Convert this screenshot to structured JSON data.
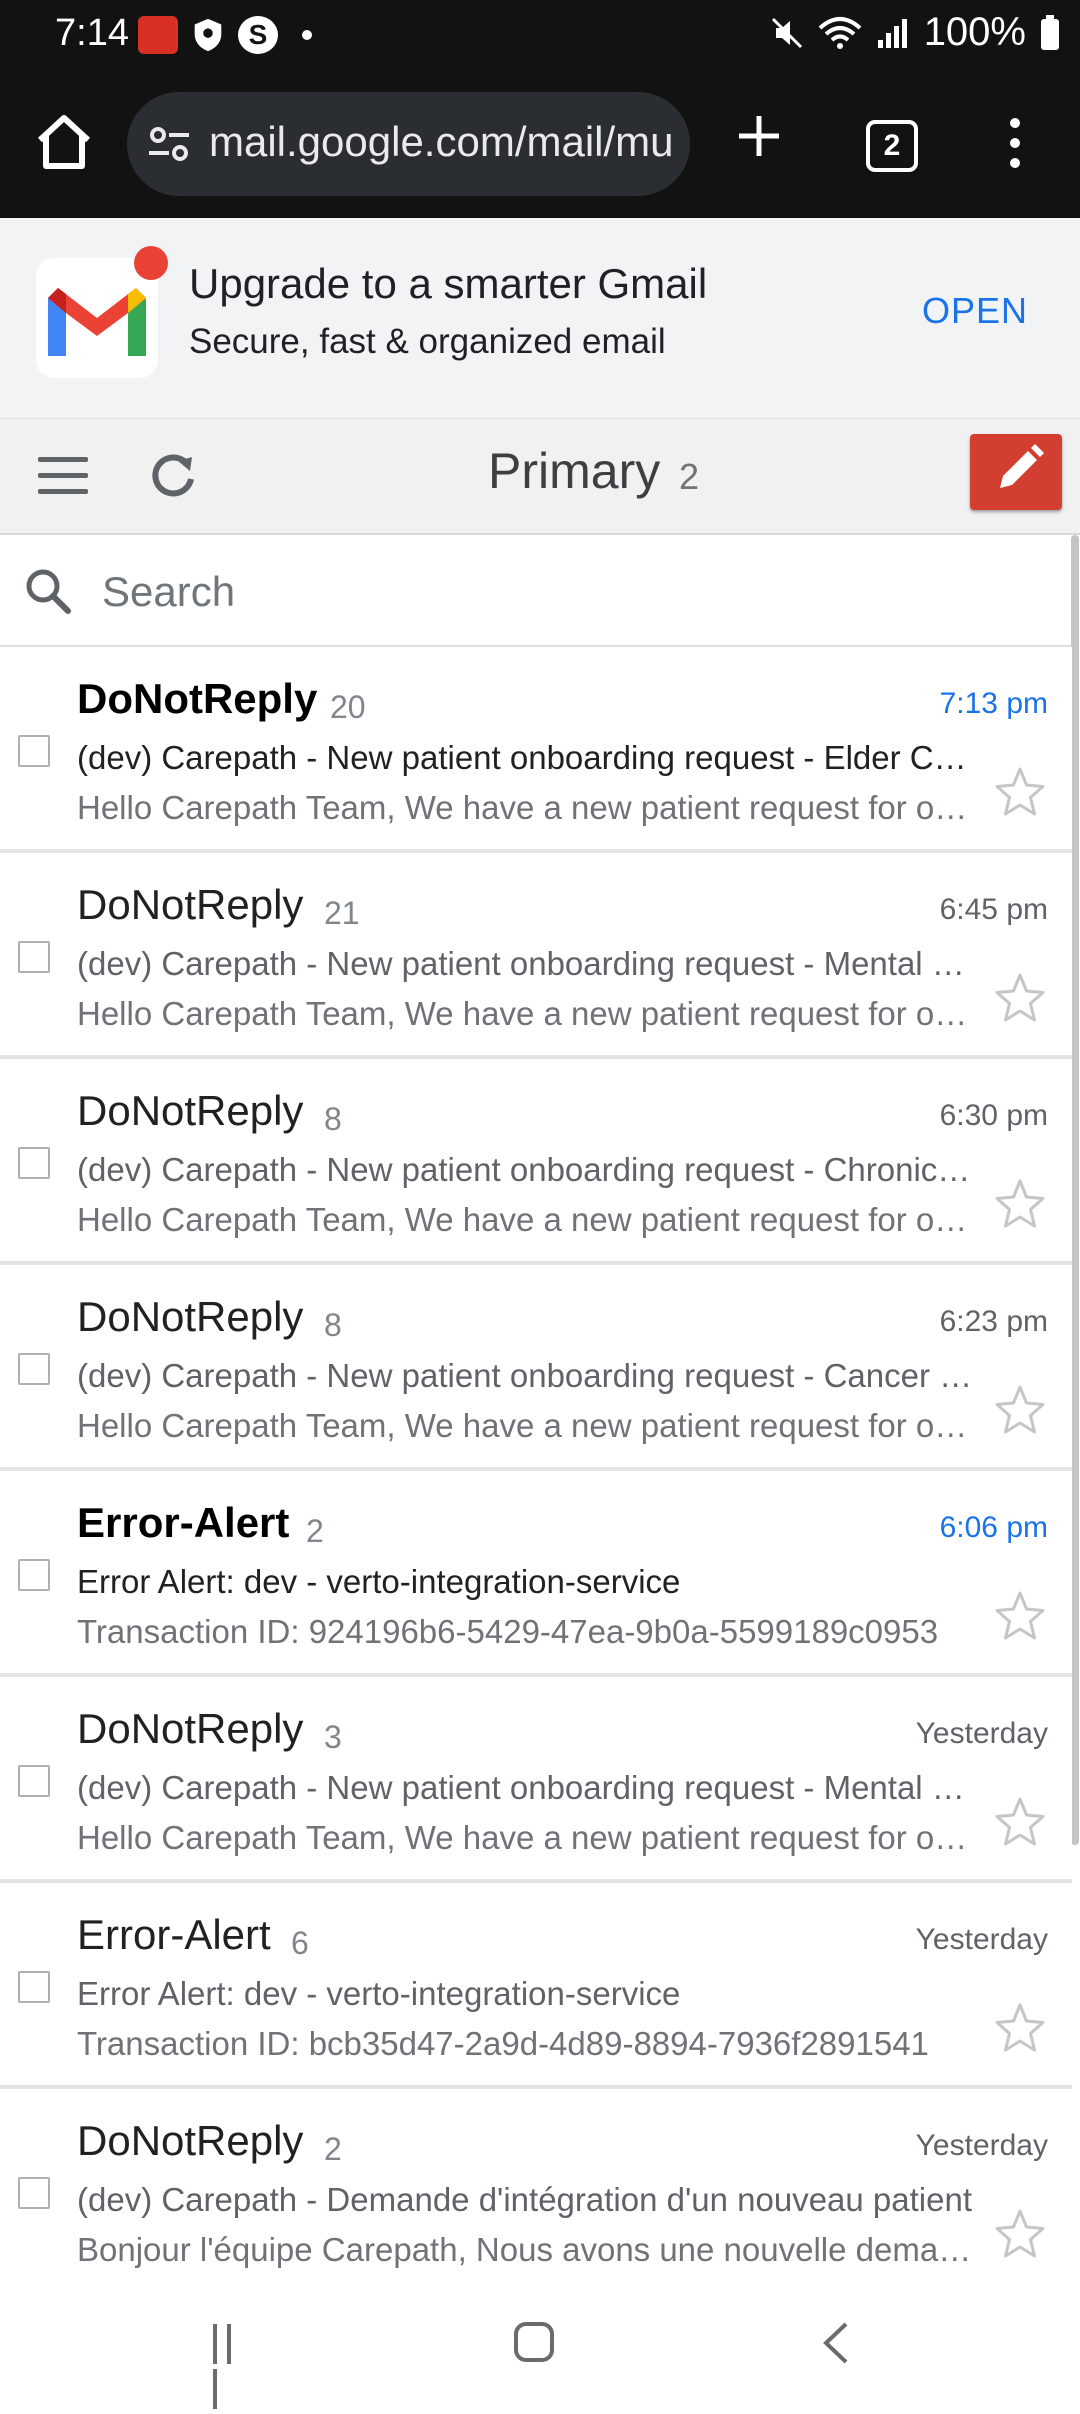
{
  "status_bar": {
    "time": "7:14",
    "battery": "100%",
    "icons": [
      "app-icon",
      "vpn-shield-icon",
      "s-app-icon",
      "notification-dot-icon",
      "mute-icon",
      "wifi-icon",
      "signal-icon",
      "battery-icon"
    ]
  },
  "browser": {
    "url": "mail.google.com/mail/mu",
    "tab_count": "2",
    "icons": [
      "home-icon",
      "site-settings-icon",
      "new-tab-icon",
      "tab-switcher-icon",
      "more-menu-icon"
    ]
  },
  "banner": {
    "title": "Upgrade to a smarter Gmail",
    "subtitle": "Secure, fast & organized email",
    "open_label": "OPEN"
  },
  "header": {
    "folder": "Primary",
    "unread_count": "2"
  },
  "search": {
    "placeholder": "Search"
  },
  "colors": {
    "accent_blue": "#1a73e8",
    "compose_red": "#d23f31",
    "toolbar_dark": "#121212"
  },
  "emails": [
    {
      "sender": "DoNotReply",
      "count": "20",
      "time": "7:13 pm",
      "unread": true,
      "subject": "(dev) Carepath - New patient onboarding request - Elder Care",
      "snippet": "Hello Carepath Team, We have a new patient request for onboarding"
    },
    {
      "sender": "DoNotReply",
      "count": "21",
      "time": "6:45 pm",
      "unread": false,
      "subject": "(dev) Carepath - New patient onboarding request - Mental Health",
      "snippet": "Hello Carepath Team, We have a new patient request for onboarding"
    },
    {
      "sender": "DoNotReply",
      "count": "8",
      "time": "6:30 pm",
      "unread": false,
      "subject": "(dev) Carepath - New patient onboarding request - Chronic Disease",
      "snippet": "Hello Carepath Team, We have a new patient request for onboarding"
    },
    {
      "sender": "DoNotReply",
      "count": "8",
      "time": "6:23 pm",
      "unread": false,
      "subject": "(dev) Carepath - New patient onboarding request - Cancer Care",
      "snippet": "Hello Carepath Team, We have a new patient request for onboarding"
    },
    {
      "sender": "Error-Alert",
      "count": "2",
      "time": "6:06 pm",
      "unread": true,
      "subject": "Error Alert: dev - verto-integration-service",
      "snippet": "Transaction ID: 924196b6-5429-47ea-9b0a-5599189c0953"
    },
    {
      "sender": "DoNotReply",
      "count": "3",
      "time": "Yesterday",
      "unread": false,
      "subject": "(dev) Carepath - New patient onboarding request - Mental Health",
      "snippet": "Hello Carepath Team, We have a new patient request for onboarding"
    },
    {
      "sender": "Error-Alert",
      "count": "6",
      "time": "Yesterday",
      "unread": false,
      "subject": "Error Alert: dev - verto-integration-service",
      "snippet": "Transaction ID: bcb35d47-2a9d-4d89-8894-7936f2891541"
    },
    {
      "sender": "DoNotReply",
      "count": "2",
      "time": "Yesterday",
      "unread": false,
      "subject": "(dev) Carepath - Demande d'intégration d'un nouveau patient",
      "snippet": "Bonjour l'équipe Carepath, Nous avons une nouvelle demande"
    }
  ]
}
